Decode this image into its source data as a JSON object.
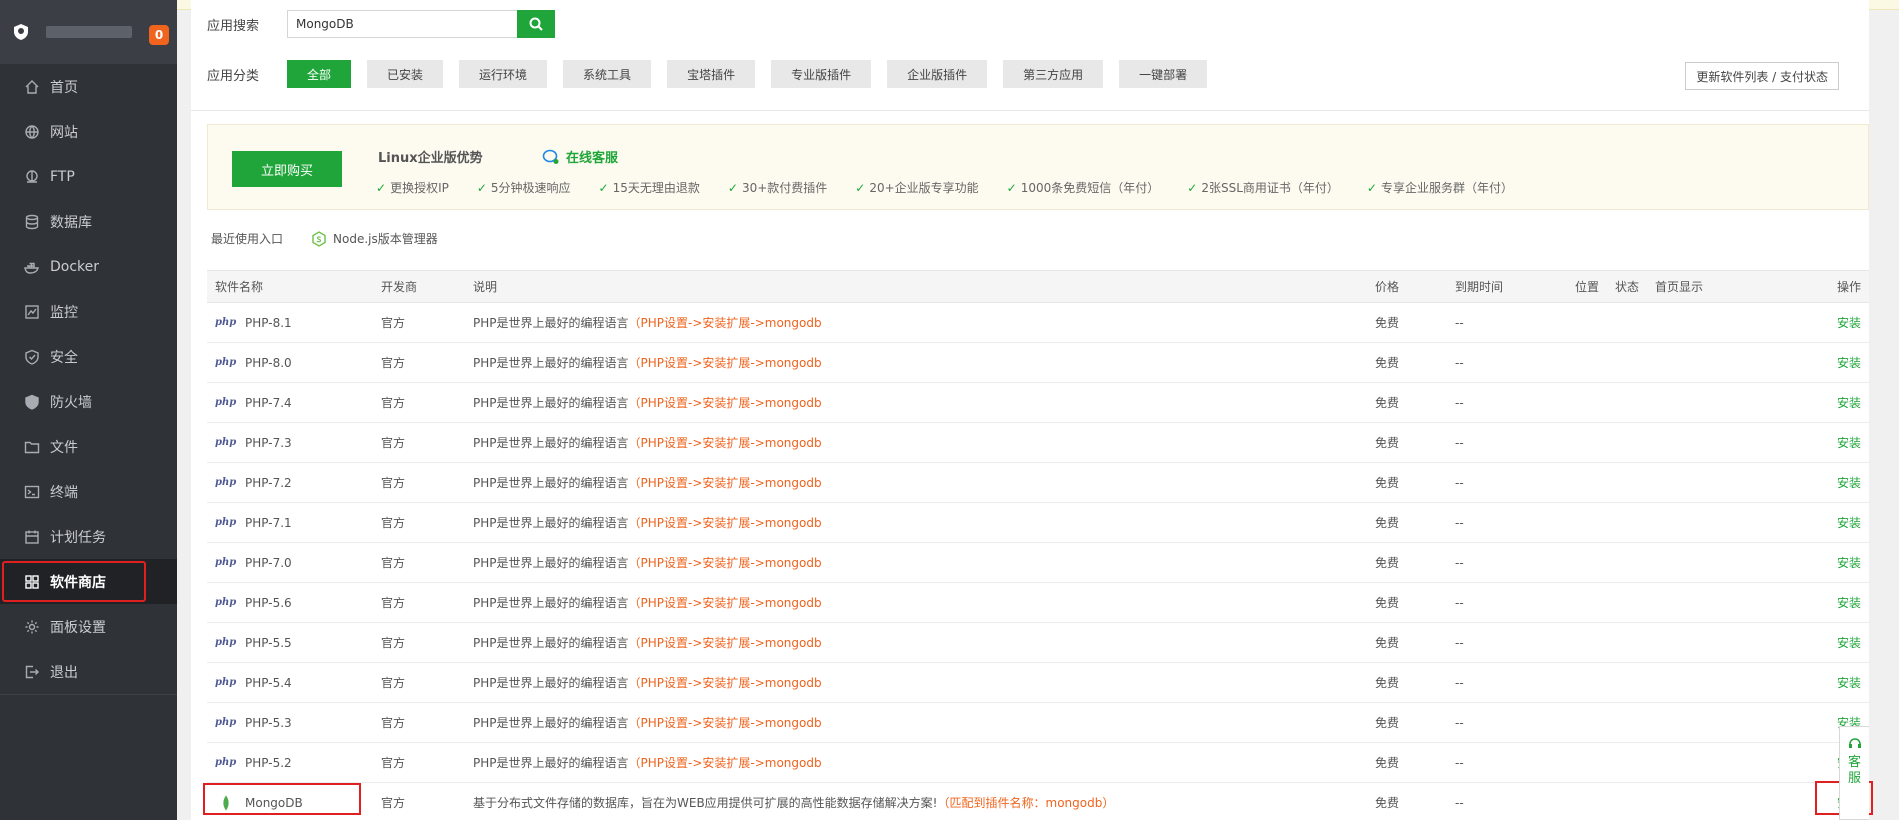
{
  "sidebar": {
    "badge": "0",
    "items": [
      {
        "label": "首页",
        "icon": "home-icon"
      },
      {
        "label": "网站",
        "icon": "globe-icon"
      },
      {
        "label": "FTP",
        "icon": "ftp-icon"
      },
      {
        "label": "数据库",
        "icon": "database-icon"
      },
      {
        "label": "Docker",
        "icon": "docker-icon"
      },
      {
        "label": "监控",
        "icon": "monitor-icon"
      },
      {
        "label": "安全",
        "icon": "shield-icon"
      },
      {
        "label": "防火墙",
        "icon": "firewall-icon"
      },
      {
        "label": "文件",
        "icon": "folder-icon"
      },
      {
        "label": "终端",
        "icon": "terminal-icon"
      },
      {
        "label": "计划任务",
        "icon": "calendar-icon"
      },
      {
        "label": "软件商店",
        "icon": "apps-icon"
      },
      {
        "label": "面板设置",
        "icon": "gear-icon"
      },
      {
        "label": "退出",
        "icon": "logout-icon"
      }
    ]
  },
  "search": {
    "label": "应用搜索",
    "value": "MongoDB"
  },
  "categories": {
    "label": "应用分类",
    "items": [
      "全部",
      "已安装",
      "运行环境",
      "系统工具",
      "宝塔插件",
      "专业版插件",
      "企业版插件",
      "第三方应用",
      "一键部署"
    ]
  },
  "update_button": "更新软件列表 / 支付状态",
  "promo": {
    "buy": "立即购买",
    "title": "Linux企业版优势",
    "service": "在线客服",
    "features": [
      "更换授权IP",
      "5分钟极速响应",
      "15天无理由退款",
      "30+款付费插件",
      "20+企业版专享功能",
      "1000条免费短信（年付）",
      "2张SSL商用证书（年付）",
      "专享企业服务群（年付）"
    ]
  },
  "recent": {
    "label": "最近使用入口",
    "item": "Node.js版本管理器"
  },
  "table": {
    "headers": [
      "软件名称",
      "开发商",
      "说明",
      "价格",
      "到期时间",
      "位置",
      "状态",
      "首页显示",
      "操作"
    ],
    "rows": [
      {
        "name": "PHP-8.1",
        "dev": "官方",
        "desc": "PHP是世界上最好的编程语言",
        "hint": "（PHP设置->安装扩展->mongodb",
        "price": "免费",
        "expire": "--",
        "op": "安装"
      },
      {
        "name": "PHP-8.0",
        "dev": "官方",
        "desc": "PHP是世界上最好的编程语言",
        "hint": "（PHP设置->安装扩展->mongodb",
        "price": "免费",
        "expire": "--",
        "op": "安装"
      },
      {
        "name": "PHP-7.4",
        "dev": "官方",
        "desc": "PHP是世界上最好的编程语言",
        "hint": "（PHP设置->安装扩展->mongodb",
        "price": "免费",
        "expire": "--",
        "op": "安装"
      },
      {
        "name": "PHP-7.3",
        "dev": "官方",
        "desc": "PHP是世界上最好的编程语言",
        "hint": "（PHP设置->安装扩展->mongodb",
        "price": "免费",
        "expire": "--",
        "op": "安装"
      },
      {
        "name": "PHP-7.2",
        "dev": "官方",
        "desc": "PHP是世界上最好的编程语言",
        "hint": "（PHP设置->安装扩展->mongodb",
        "price": "免费",
        "expire": "--",
        "op": "安装"
      },
      {
        "name": "PHP-7.1",
        "dev": "官方",
        "desc": "PHP是世界上最好的编程语言",
        "hint": "（PHP设置->安装扩展->mongodb",
        "price": "免费",
        "expire": "--",
        "op": "安装"
      },
      {
        "name": "PHP-7.0",
        "dev": "官方",
        "desc": "PHP是世界上最好的编程语言",
        "hint": "（PHP设置->安装扩展->mongodb",
        "price": "免费",
        "expire": "--",
        "op": "安装"
      },
      {
        "name": "PHP-5.6",
        "dev": "官方",
        "desc": "PHP是世界上最好的编程语言",
        "hint": "（PHP设置->安装扩展->mongodb",
        "price": "免费",
        "expire": "--",
        "op": "安装"
      },
      {
        "name": "PHP-5.5",
        "dev": "官方",
        "desc": "PHP是世界上最好的编程语言",
        "hint": "（PHP设置->安装扩展->mongodb",
        "price": "免费",
        "expire": "--",
        "op": "安装"
      },
      {
        "name": "PHP-5.4",
        "dev": "官方",
        "desc": "PHP是世界上最好的编程语言",
        "hint": "（PHP设置->安装扩展->mongodb",
        "price": "免费",
        "expire": "--",
        "op": "安装"
      },
      {
        "name": "PHP-5.3",
        "dev": "官方",
        "desc": "PHP是世界上最好的编程语言",
        "hint": "（PHP设置->安装扩展->mongodb",
        "price": "免费",
        "expire": "--",
        "op": "安装"
      },
      {
        "name": "PHP-5.2",
        "dev": "官方",
        "desc": "PHP是世界上最好的编程语言",
        "hint": "（PHP设置->安装扩展->mongodb",
        "price": "免费",
        "expire": "--",
        "op": "安装"
      }
    ],
    "mongo": {
      "name": "MongoDB",
      "dev": "官方",
      "desc": "基于分布式文件存储的数据库，旨在为WEB应用提供可扩展的高性能数据存储解决方案!",
      "hint": "（匹配到插件名称：mongodb）",
      "price": "免费",
      "expire": "--",
      "op": "安装"
    }
  },
  "php_label": "php",
  "float_service": [
    "客",
    "服"
  ]
}
